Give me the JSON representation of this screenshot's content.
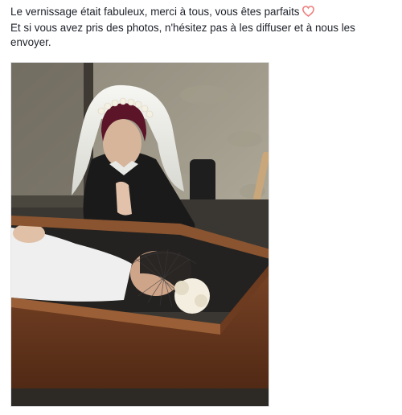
{
  "post": {
    "line1": "Le vernissage était fabuleux, merci à tous, vous êtes parfaits",
    "line2": "Et si vous avez pris des photos, n'hésitez pas à les diffuser et à nous les envoyer.",
    "heart_icon": "heart-emoji",
    "heart_color": "#f07c7c"
  },
  "photo": {
    "subject": "photo-woman-in-veil-praying-over-person-in-coffin"
  }
}
